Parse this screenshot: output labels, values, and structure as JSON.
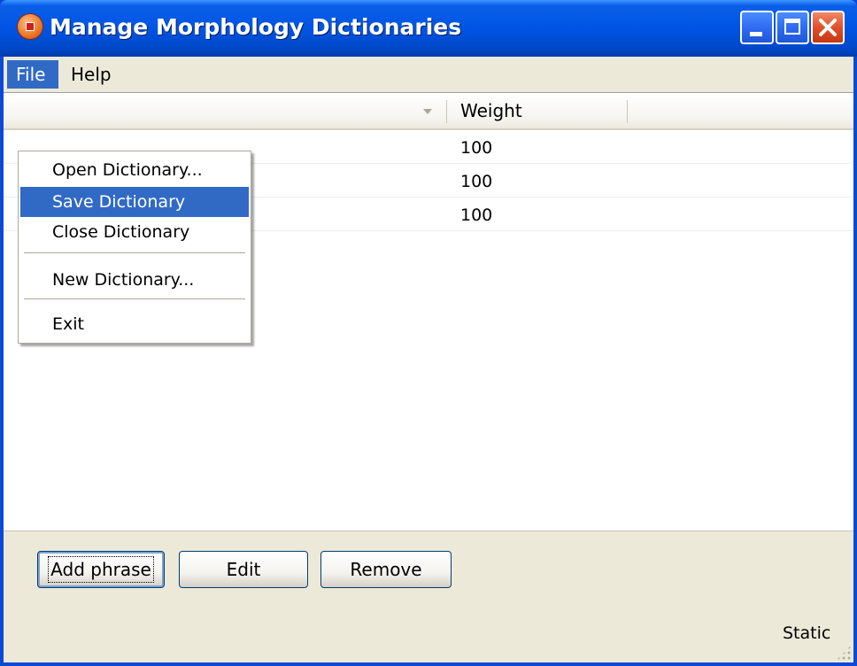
{
  "window": {
    "title": "Manage Morphology Dictionaries",
    "app_icon": "app-orange-icon",
    "controls": {
      "minimize": "minimize-icon",
      "maximize": "maximize-icon",
      "close": "close-icon"
    }
  },
  "menubar": {
    "items": [
      {
        "label": "File",
        "active": true
      },
      {
        "label": "Help",
        "active": false
      }
    ]
  },
  "file_menu": {
    "items": [
      {
        "label": "Open Dictionary...",
        "highlighted": false
      },
      {
        "label": "Save Dictionary",
        "highlighted": true
      },
      {
        "label": "Close Dictionary",
        "highlighted": false
      },
      {
        "label": "New Dictionary...",
        "highlighted": false
      },
      {
        "label": "Exit",
        "highlighted": false
      }
    ]
  },
  "table": {
    "columns": [
      {
        "label": "",
        "sortable": true
      },
      {
        "label": "Weight"
      }
    ],
    "rows": [
      {
        "weight": "100"
      },
      {
        "weight": "100"
      },
      {
        "weight": "100"
      }
    ]
  },
  "buttons": {
    "add": "Add phrase",
    "edit": "Edit",
    "remove": "Remove"
  },
  "status": {
    "text": "Static"
  },
  "colors": {
    "titlebar": "#0054e3",
    "highlight": "#316ac5",
    "face": "#ece9d8",
    "close_button": "#e0502a"
  }
}
